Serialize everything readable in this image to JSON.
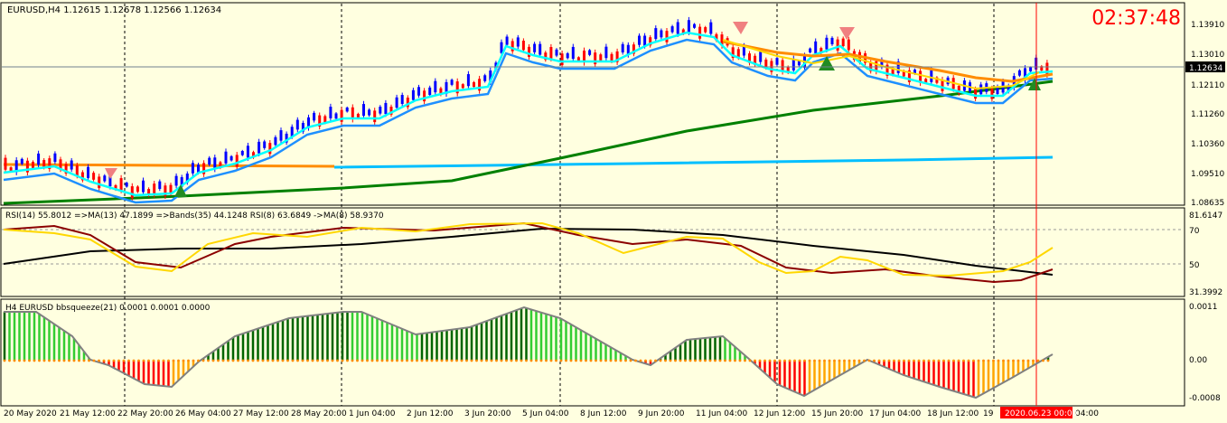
{
  "main": {
    "header": "EURUSD,H4  1.12615 1.12678 1.12566 1.12634",
    "clock": "02:37:48",
    "price_ticks": [
      "1.13910",
      "1.13010",
      "1.12110",
      "1.11260",
      "1.10360",
      "1.09510",
      "1.08635"
    ],
    "current_price": "1.12634"
  },
  "rsi": {
    "header": "RSI(14) 55.8012  =>MA(13) 47.1899  =>Bands(35) 44.1248  RSI(8) 63.6849  ->MA(8) 58.9370",
    "ticks": [
      "81.6147",
      "70",
      "50",
      "31.3992"
    ]
  },
  "squeeze": {
    "header": "H4 EURUSD bbsqueeze(21) 0.0001 0.0001 0.0000",
    "ticks": [
      "0.0011",
      "0.00",
      "-0.0008"
    ]
  },
  "time_axis": {
    "labels": [
      "20 May 2020",
      "21 May 12:00",
      "22 May 20:00",
      "26 May 04:00",
      "27 May 12:00",
      "28 May 20:00",
      "1 Jun 04:00",
      "2 Jun 12:00",
      "3 Jun 20:00",
      "5 Jun 04:00",
      "8 Jun 12:00",
      "9 Jun 20:00",
      "11 Jun 04:00",
      "12 Jun 12:00",
      "15 Jun 20:00",
      "17 Jun 04:00",
      "18 Jun 12:00",
      "19",
      "04:00"
    ],
    "highlight": "2020.06.23 00:00"
  },
  "colors": {
    "bg": "#ffffe0",
    "bull": "#0000ff",
    "bear": "#ff0000",
    "ma_cyan": "#00ffff",
    "ma_blue": "#1e90ff",
    "ma_orange": "#ff8c00",
    "ma_yellow": "#ffd700",
    "ma_green": "#008000",
    "ma_lightblue": "#00bfff",
    "hist_dkgreen": "#006400",
    "hist_ltgreen": "#32cd32",
    "hist_red": "#ff0000",
    "hist_orange": "#ffa500"
  }
}
